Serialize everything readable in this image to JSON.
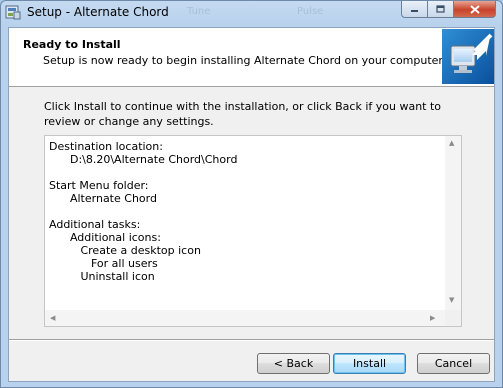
{
  "window": {
    "title": "Setup - Alternate Chord",
    "ghost_tabs": [
      "Tune",
      "Pulse"
    ],
    "controls": {
      "minimize_icon": "minimize-icon",
      "maximize_icon": "maximize-icon",
      "close_icon": "close-icon"
    }
  },
  "header": {
    "title": "Ready to Install",
    "subtitle": "Setup is now ready to begin installing Alternate Chord on your computer.",
    "image_icon": "computer-install-icon"
  },
  "intro": "Click Install to continue with the installation, or click Back if you want to review or change any settings.",
  "memo": {
    "lines": [
      "Destination location:",
      "      D:\\8.20\\Alternate Chord\\Chord",
      "",
      "Start Menu folder:",
      "      Alternate Chord",
      "",
      "Additional tasks:",
      "      Additional icons:",
      "         Create a desktop icon",
      "            For all users",
      "         Uninstall icon"
    ]
  },
  "buttons": {
    "back": "< Back",
    "install": "Install",
    "cancel": "Cancel"
  },
  "colors": {
    "titlebar": "#b8d1ec",
    "client_bg": "#f0f0f0",
    "header_bg": "#ffffff",
    "default_button_border": "#3c7fb1",
    "close_button": "#c7432b"
  }
}
